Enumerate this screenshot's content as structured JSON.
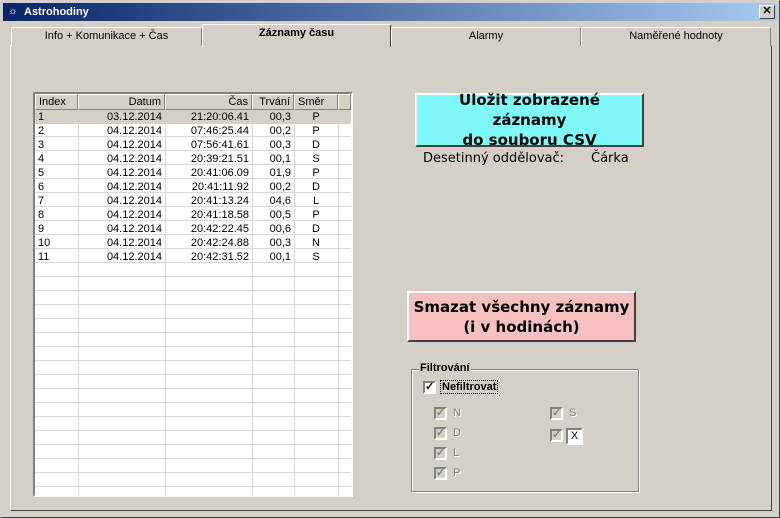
{
  "window": {
    "title": "Astrohodiny",
    "close_symbol": "✕"
  },
  "tabs": [
    {
      "label": "Info + Komunikace + Čas"
    },
    {
      "label": "Záznamy času"
    },
    {
      "label": "Alarmy"
    },
    {
      "label": "Naměřené hodnoty"
    }
  ],
  "table": {
    "headers": [
      "Index",
      "Datum",
      "Čas",
      "Trvání",
      "Směr"
    ],
    "rows": [
      [
        "1",
        "03.12.2014",
        "21:20:06.41",
        "00,3",
        "P"
      ],
      [
        "2",
        "04.12.2014",
        "07:46:25.44",
        "00,2",
        "P"
      ],
      [
        "3",
        "04.12.2014",
        "07:56:41.61",
        "00,3",
        "D"
      ],
      [
        "4",
        "04.12.2014",
        "20:39:21.51",
        "00,1",
        "S"
      ],
      [
        "5",
        "04.12.2014",
        "20:41:06.09",
        "01,9",
        "P"
      ],
      [
        "6",
        "04.12.2014",
        "20:41:11.92",
        "00,2",
        "D"
      ],
      [
        "7",
        "04.12.2014",
        "20:41:13.24",
        "04,6",
        "L"
      ],
      [
        "8",
        "04.12.2014",
        "20:41:18.58",
        "00,5",
        "P"
      ],
      [
        "9",
        "04.12.2014",
        "20:42:22.45",
        "00,6",
        "D"
      ],
      [
        "10",
        "04.12.2014",
        "20:42:24.88",
        "00,3",
        "N"
      ],
      [
        "11",
        "04.12.2014",
        "20:42:31.52",
        "00,1",
        "S"
      ]
    ]
  },
  "export": {
    "button_line1": "Uložit zobrazené záznamy",
    "button_line2": "do souboru CSV",
    "separator_label": "Desetinný oddělovač:",
    "separator_value": "Čárka",
    "color": "#7ff8f8"
  },
  "delete": {
    "button_line1": "Smazat všechny záznamy",
    "button_line2": "(i v hodinách)",
    "color": "#f7c0c0"
  },
  "filter": {
    "legend": "Filtrování",
    "no_filter_label": "Nefiltrovat",
    "no_filter_checked": true,
    "items": [
      {
        "label": "N",
        "checked": true
      },
      {
        "label": "D",
        "checked": true
      },
      {
        "label": "L",
        "checked": true
      },
      {
        "label": "P",
        "checked": true
      },
      {
        "label": "S",
        "checked": true
      },
      {
        "label": "",
        "checked": true,
        "input_value": "X"
      }
    ]
  }
}
